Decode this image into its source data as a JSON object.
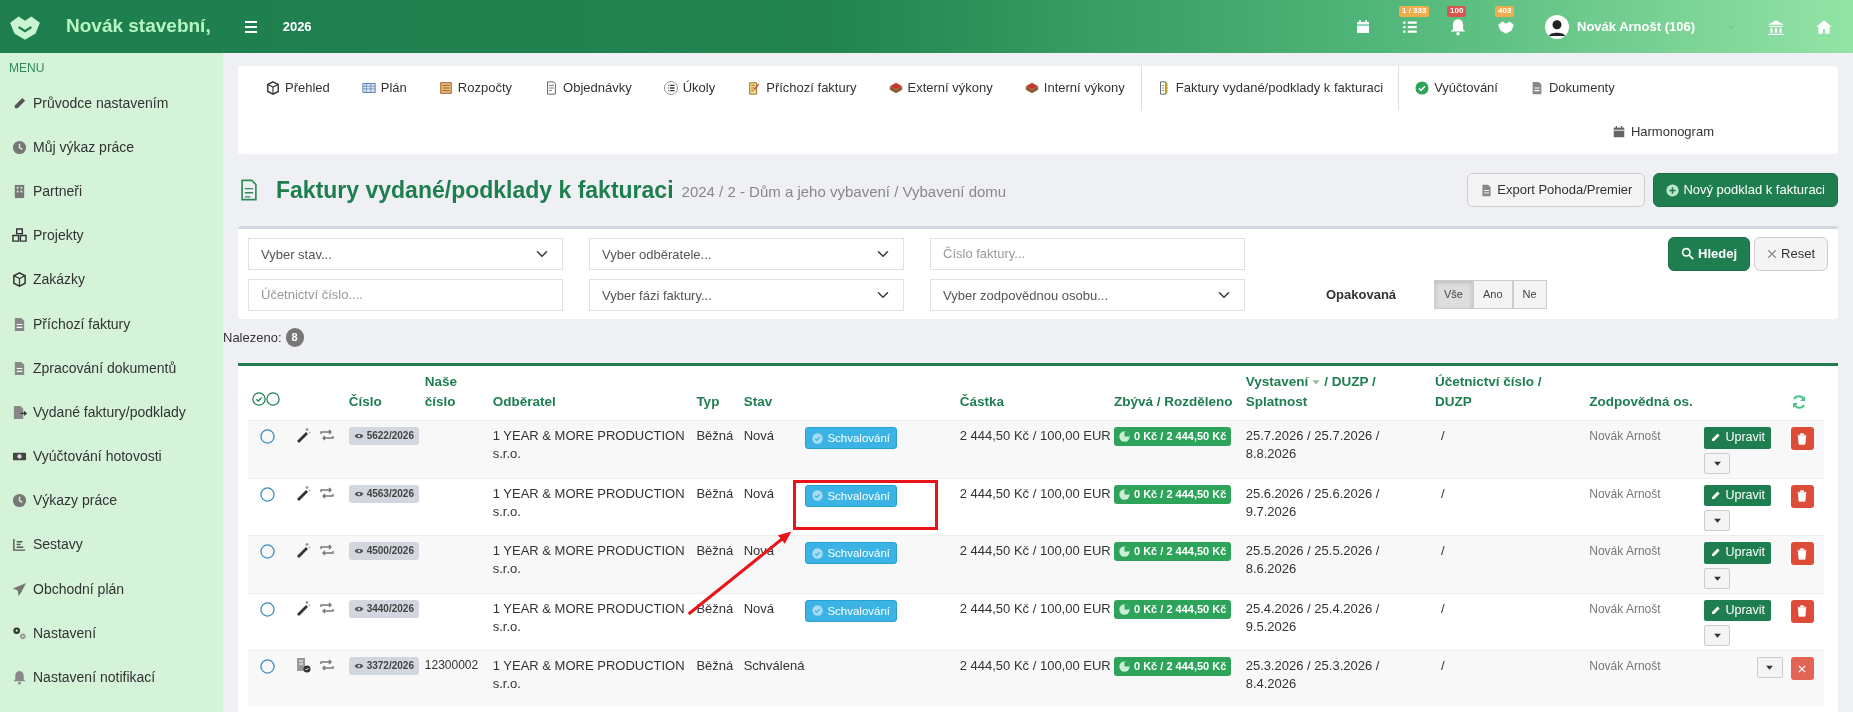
{
  "topbar": {
    "brand": "Novák stavební,",
    "year": "2026",
    "badges": [
      {
        "count": "1 / 333",
        "color": "#f0ad4e"
      },
      {
        "count": "100",
        "color": "#d9534f"
      },
      {
        "count": "403",
        "color": "#f0ad4e"
      }
    ],
    "user": "Novák Arnošt (106)"
  },
  "sidebar": {
    "heading": "MENU",
    "items": [
      {
        "label": "Průvodce nastavením"
      },
      {
        "label": "Můj výkaz práce"
      },
      {
        "label": "Partneři"
      },
      {
        "label": "Projekty"
      },
      {
        "label": "Zakázky"
      },
      {
        "label": "Příchozí faktury"
      },
      {
        "label": "Zpracování dokumentů"
      },
      {
        "label": "Vydané faktury/podklady"
      },
      {
        "label": "Vyúčtování hotovosti"
      },
      {
        "label": "Výkazy práce"
      },
      {
        "label": "Sestavy"
      },
      {
        "label": "Obchodní plán"
      },
      {
        "label": "Nastavení"
      },
      {
        "label": "Nastavení notifikací"
      }
    ]
  },
  "tabs": [
    {
      "label": "Přehled",
      "selected": false
    },
    {
      "label": "Plán",
      "selected": false
    },
    {
      "label": "Rozpočty",
      "selected": false
    },
    {
      "label": "Objednávky",
      "selected": false
    },
    {
      "label": "Úkoly",
      "selected": false
    },
    {
      "label": "Příchozí faktury",
      "selected": false
    },
    {
      "label": "Externí výkony",
      "selected": false
    },
    {
      "label": "Interní výkony",
      "selected": false
    },
    {
      "label": "Faktury vydané/podklady k fakturaci",
      "selected": true
    },
    {
      "label": "Vyúčtování",
      "selected": false
    },
    {
      "label": "Dokumenty",
      "selected": false
    },
    {
      "label": "Harmonogram",
      "selected": false
    }
  ],
  "page": {
    "title": "Faktury vydané/podklady k fakturaci",
    "breadcrumb": "2024 / 2 - Dům a jeho vybavení / Vybavení domu",
    "export_button": "Export Pohoda/Premier",
    "new_button": "Nový podklad k fakturaci"
  },
  "filters": {
    "status_select": "Vyber stav...",
    "customer_select": "Vyber odběratele...",
    "invoice_number": {
      "placeholder": "Číslo faktury..."
    },
    "search_button": "Hledej",
    "reset_button": "Reset",
    "accounting_number": {
      "placeholder": "Účetnictví číslo...."
    },
    "phase_select": "Vyber fázi faktury...",
    "person_select": "Vyber zodpovědnou osobu...",
    "recurring": {
      "label": "Opakovaná",
      "options": [
        {
          "label": "Vše",
          "selected": true
        },
        {
          "label": "Ano",
          "selected": false
        },
        {
          "label": "Ne",
          "selected": false
        }
      ]
    }
  },
  "found": {
    "label": "Nalezeno:",
    "count": "8"
  },
  "table": {
    "columns": [
      {
        "label": "Číslo"
      },
      {
        "label": "Naše číslo"
      },
      {
        "label": "Odběratel"
      },
      {
        "label": "Typ"
      },
      {
        "label": "Stav"
      },
      {
        "label": "Částka"
      },
      {
        "label": "Zbývá / Rozděleno"
      },
      {
        "label": "Vystavení",
        "sorted": true,
        "label_after": "/ DUZP /",
        "label_second_line": "Splatnost"
      },
      {
        "label": "Účetnictví číslo / DUZP"
      },
      {
        "label": "Zodpovědná os."
      }
    ],
    "rows": [
      {
        "kind": "draft",
        "selected": false,
        "highlighted": false,
        "arrow_origin": false,
        "number": "5622/2026",
        "customer": "1 YEAR & MORE PRODUCTION s.r.o.",
        "type": "Běžná",
        "state": "Nová",
        "approval": "Schvalování",
        "amount": "2 444,50 Kč / 100,00 EUR",
        "remaining": "0 Kč / 2 444,50 Kč",
        "dates": "25.7.2026 / 25.7.2026 / 8.8.2026",
        "accounting": "/",
        "person": "Novák Arnošt",
        "edit": "Upravit"
      },
      {
        "kind": "draft",
        "selected": false,
        "highlighted": true,
        "arrow_origin": false,
        "number": "4563/2026",
        "customer": "1 YEAR & MORE PRODUCTION s.r.o.",
        "type": "Běžná",
        "state": "Nová",
        "approval": "Schvalování",
        "amount": "2 444,50 Kč / 100,00 EUR",
        "remaining": "0 Kč / 2 444,50 Kč",
        "dates": "25.6.2026 / 25.6.2026 / 9.7.2026",
        "accounting": "/",
        "person": "Novák Arnošt",
        "edit": "Upravit"
      },
      {
        "kind": "draft",
        "selected": false,
        "highlighted": false,
        "arrow_origin": false,
        "number": "4500/2026",
        "customer": "1 YEAR & MORE PRODUCTION s.r.o.",
        "type": "Běžná",
        "state": "Nová",
        "approval": "Schvalování",
        "amount": "2 444,50 Kč / 100,00 EUR",
        "remaining": "0 Kč / 2 444,50 Kč",
        "dates": "25.5.2026 / 25.5.2026 / 8.6.2026",
        "accounting": "/",
        "person": "Novák Arnošt",
        "edit": "Upravit"
      },
      {
        "kind": "draft",
        "selected": false,
        "highlighted": false,
        "arrow_origin": true,
        "number": "3440/2026",
        "customer": "1 YEAR & MORE PRODUCTION s.r.o.",
        "type": "Běžná",
        "state": "Nová",
        "approval": "Schvalování",
        "amount": "2 444,50 Kč / 100,00 EUR",
        "remaining": "0 Kč / 2 444,50 Kč",
        "dates": "25.4.2026 / 25.4.2026 / 9.5.2026",
        "accounting": "/",
        "person": "Novák Arnošt",
        "edit": "Upravit"
      },
      {
        "kind": "approved",
        "selected": false,
        "highlighted": false,
        "arrow_origin": false,
        "number": "3372/2026",
        "our_number": "12300002",
        "customer": "1 YEAR & MORE PRODUCTION s.r.o.",
        "type": "Běžná",
        "state": "Schválená",
        "amount": "2 444,50 Kč / 100,00 EUR",
        "remaining": "0 Kč / 2 444,50 Kč",
        "dates": "25.3.2026 / 25.3.2026 / 8.4.2026",
        "accounting": "/",
        "person": "Novák Arnošt"
      }
    ]
  }
}
